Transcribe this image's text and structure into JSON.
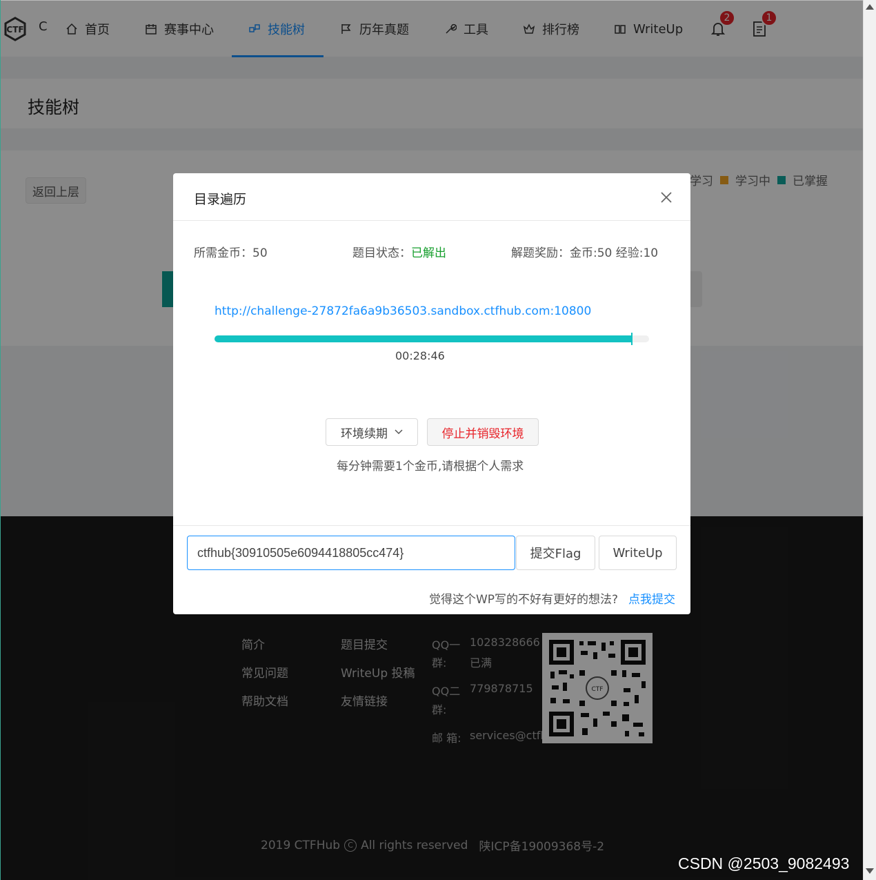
{
  "nav": {
    "logo_text": "C",
    "items": [
      {
        "label": "首页",
        "icon": "home-icon"
      },
      {
        "label": "赛事中心",
        "icon": "calendar-icon"
      },
      {
        "label": "技能树",
        "icon": "skill-tree-icon"
      },
      {
        "label": "历年真题",
        "icon": "flag-icon"
      },
      {
        "label": "工具",
        "icon": "wrench-icon"
      },
      {
        "label": "排行榜",
        "icon": "crown-icon"
      },
      {
        "label": "WriteUp",
        "icon": "book-icon"
      }
    ],
    "active_index": 2,
    "notification_count": "2",
    "todo_count": "1"
  },
  "page": {
    "title": "技能树",
    "back_button": "返回上层",
    "legend": [
      {
        "label": "学习",
        "color": "#bfbfbf"
      },
      {
        "label": "学习中",
        "color": "#f5a623"
      },
      {
        "label": "已掌握",
        "color": "#13a89e"
      }
    ]
  },
  "modal": {
    "title": "目录遍历",
    "coins_label": "所需金币：",
    "coins_value": "50",
    "status_label": "题目状态：",
    "status_value": "已解出",
    "reward_label": "解题奖励：",
    "reward_value": "金币:50 经验:10",
    "challenge_url": "http://challenge-27872fa6a9b36503.sandbox.ctfhub.com:10800",
    "timer": "00:28:46",
    "progress_fraction": 0.96,
    "renew_button": "环境续期",
    "destroy_button": "停止并销毁环境",
    "hint": "每分钟需要1个金币,请根据个人需求",
    "flag_value": "ctfhub{30910505e6094418805cc474}",
    "submit_flag_button": "提交Flag",
    "writeup_button": "WriteUp",
    "wp_note": "觉得这个WP写的不好有更好的想法?",
    "wp_link": "点我提交"
  },
  "footer": {
    "col1": [
      "简介",
      "常见问题",
      "帮助文档"
    ],
    "col2": [
      "题目提交",
      "WriteUp 投稿",
      "友情链接"
    ],
    "qq1_label": "QQ一",
    "qq1_label2": "群:",
    "qq1_value": "1028328666",
    "qq1_status": "已满",
    "qq2_label": "QQ二",
    "qq2_label2": "群:",
    "qq2_value": "779878715",
    "email_label": "邮 箱:",
    "email_value": "services@ctfh",
    "copyright_year": "2019 CTFHub",
    "copyright_text": "All rights reserved",
    "icp": "陕ICP备19009368号-2"
  },
  "watermark": "CSDN @2503_9082493",
  "colors": {
    "accent": "#1890ff",
    "teal": "#13c2c2",
    "danger": "#e8242a",
    "success": "#159e2c"
  }
}
